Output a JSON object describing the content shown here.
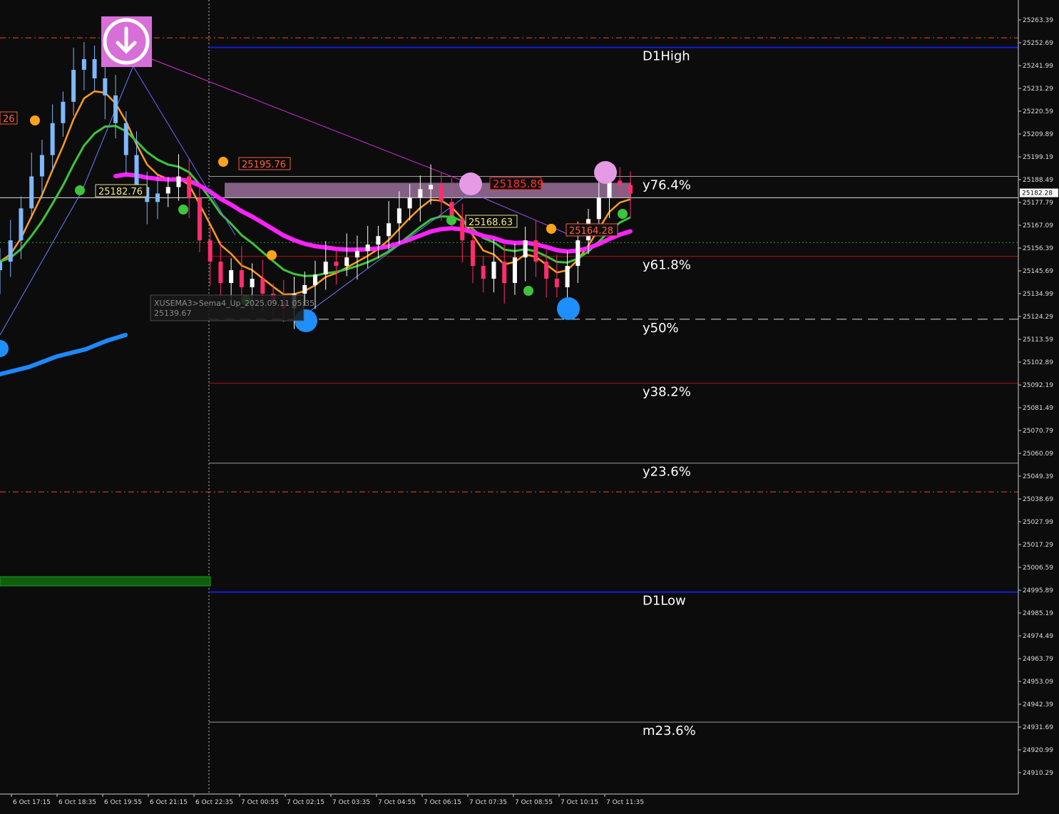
{
  "chart_data": {
    "type": "candlestick",
    "symbol_note": "XUSEMA3>Sema4_Up_2025.09.11 05:35",
    "note_value": "25139.67",
    "colors": {
      "background": "#0c0c0c",
      "candle_up": "#ffffff",
      "candle_down": "#ff2d6e",
      "early_candles": "#7fb8ff",
      "ema_fast": "#ff9a1f",
      "ema_mid": "#3cc43c",
      "ema_slow": "#ff22ff",
      "ema_long": "#1e88ff",
      "fib_line_white": "#9a9a9a",
      "fib_line_red": "#b01010",
      "d1_line": "#1020e0",
      "dash_orange": "#e0501a"
    },
    "price_axis": {
      "ticks": [
        "25263.39",
        "25252.69",
        "25241.99",
        "25231.29",
        "25220.59",
        "25209.89",
        "25199.19",
        "25188.49",
        "25177.79",
        "25167.09",
        "25156.39",
        "25145.69",
        "25134.99",
        "25124.29",
        "25113.59",
        "25102.89",
        "25092.19",
        "25081.49",
        "25070.79",
        "25060.09",
        "25049.39",
        "25038.69",
        "25027.99",
        "25017.29",
        "25006.59",
        "24995.89",
        "24985.19",
        "24974.49",
        "24963.79",
        "24953.09",
        "24942.39",
        "24931.69",
        "24920.99",
        "24910.29"
      ],
      "current_price": "25182.28",
      "range": [
        24902.0,
        25272.0
      ]
    },
    "time_axis": {
      "labels": [
        "6 Oct 17:15",
        "6 Oct 18:35",
        "6 Oct 19:55",
        "6 Oct 21:15",
        "6 Oct 22:35",
        "7 Oct 00:55",
        "7 Oct 02:15",
        "7 Oct 03:35",
        "7 Oct 04:55",
        "7 Oct 06:15",
        "7 Oct 07:35",
        "7 Oct 08:55",
        "7 Oct 10:15",
        "7 Oct 11:35"
      ]
    },
    "levels": [
      {
        "label": "D1High",
        "price": 25250.5,
        "color": "d1"
      },
      {
        "label": "y76.4%",
        "price": 25190.0,
        "color": "white"
      },
      {
        "label": "y61.8%",
        "price": 25152.5,
        "color": "red"
      },
      {
        "label": "y50%",
        "price": 25123.0,
        "color": "dashed"
      },
      {
        "label": "y38.2%",
        "price": 25093.0,
        "color": "red"
      },
      {
        "label": "y23.6%",
        "price": 25055.5,
        "color": "white"
      },
      {
        "label": "D1Low",
        "price": 24995.0,
        "color": "d1"
      },
      {
        "label": "m23.6%",
        "price": 24934.0,
        "color": "white"
      }
    ],
    "dashed_orange_levels": [
      25255.0,
      25042.0
    ],
    "dotted_green_level": 25159.0,
    "price_labels": [
      {
        "text": "25195.76",
        "price": 25195.76,
        "color": "orange"
      },
      {
        "text": "25182.76",
        "price": 25182.76,
        "color": "yellow"
      },
      {
        "text": "25185.89",
        "price": 25185.89,
        "color": "red"
      },
      {
        "text": "25164.28",
        "price": 25164.28,
        "color": "orange"
      },
      {
        "text": "25168.63",
        "price": 25168.63,
        "color": "yellow"
      },
      {
        "text": "26",
        "price": 25204.0,
        "color": "orange"
      }
    ],
    "close_series": [
      25150,
      25160,
      25175,
      25190,
      25200,
      25215,
      25225,
      25240,
      25245,
      25236,
      25228,
      25215,
      25200,
      25185,
      25178,
      25182,
      25185,
      25190,
      25180,
      25160,
      25150,
      25140,
      25146,
      25138,
      25142,
      25135,
      25131,
      25128,
      25135,
      25139,
      25144,
      25150,
      25148,
      25152,
      25155,
      25158,
      25162,
      25168,
      25175,
      25180,
      25184,
      25186,
      25178,
      25170,
      25160,
      25148,
      25142,
      25150,
      25140,
      25152,
      25160,
      25150,
      25142,
      25138,
      25148,
      25160,
      25170,
      25180,
      25188,
      25186,
      25182
    ]
  }
}
